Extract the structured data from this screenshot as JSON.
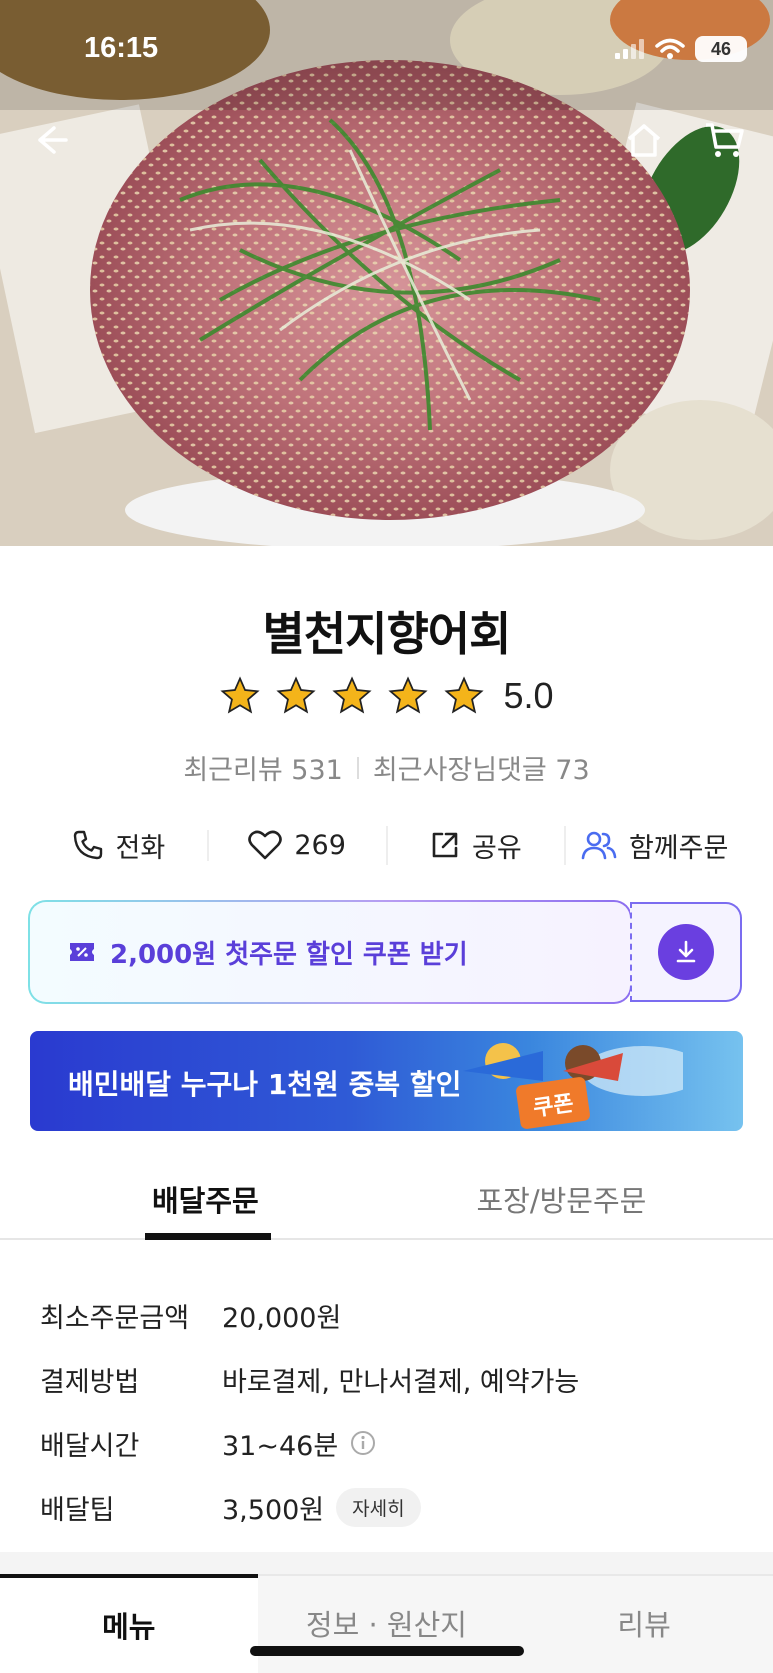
{
  "status_bar": {
    "time": "16:15",
    "battery": "46"
  },
  "icons": {
    "back": "back-arrow-icon",
    "home": "home-icon",
    "cart": "cart-icon",
    "phone": "phone-icon",
    "heart": "heart-icon",
    "share": "share-icon",
    "group": "group-order-icon",
    "coupon": "coupon-ticket-icon",
    "download": "download-icon",
    "info": "info-icon",
    "star": "star-icon"
  },
  "store": {
    "name": "별천지향어회",
    "rating": "5.0",
    "stars": 5,
    "recent_reviews": "최근리뷰 531",
    "owner_replies": "최근사장님댓글 73"
  },
  "actions": {
    "call": "전화",
    "likes": "269",
    "share": "공유",
    "group_order": "함께주문"
  },
  "coupon": {
    "text": "2,000원 첫주문 할인 쿠폰 받기"
  },
  "banner": {
    "text": "배민배달 누구나 1천원 중복 할인",
    "badge": "쿠폰"
  },
  "order_tabs": {
    "delivery": "배달주문",
    "pickup": "포장/방문주문"
  },
  "details": {
    "min_order_label": "최소주문금액",
    "min_order_value": "20,000원",
    "payment_label": "결제방법",
    "payment_value": "바로결제, 만나서결제, 예약가능",
    "time_label": "배달시간",
    "time_value": "31~46분",
    "tip_label": "배달팁",
    "tip_value": "3,500원",
    "tip_detail": "자세히"
  },
  "bottom_tabs": {
    "menu": "메뉴",
    "info": "정보 · 원산지",
    "reviews": "리뷰"
  },
  "colors": {
    "accent": "#5a3fd9",
    "star": "#f4b41a",
    "banner": "#2f5bd6"
  }
}
